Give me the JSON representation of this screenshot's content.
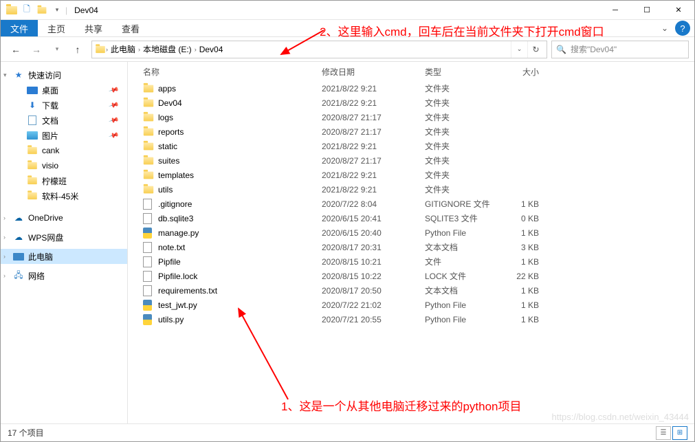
{
  "window": {
    "title": "Dev04"
  },
  "ribbon": {
    "file": "文件",
    "tabs": [
      "主页",
      "共享",
      "查看"
    ]
  },
  "nav": {
    "crumbs": [
      "此电脑",
      "本地磁盘 (E:)",
      "Dev04"
    ],
    "search_placeholder": "搜索\"Dev04\""
  },
  "sidebar": {
    "quick": "快速访问",
    "quick_items": [
      {
        "label": "桌面",
        "icon": "desktop",
        "pin": true
      },
      {
        "label": "下载",
        "icon": "download",
        "pin": true
      },
      {
        "label": "文档",
        "icon": "doc",
        "pin": true
      },
      {
        "label": "图片",
        "icon": "pic",
        "pin": true
      },
      {
        "label": "cank",
        "icon": "folder",
        "pin": false
      },
      {
        "label": "visio",
        "icon": "folder",
        "pin": false
      },
      {
        "label": "柠檬班",
        "icon": "folder",
        "pin": false
      },
      {
        "label": "软料-45米",
        "icon": "folder",
        "pin": false
      }
    ],
    "onedrive": "OneDrive",
    "wps": "WPS网盘",
    "thispc": "此电脑",
    "network": "网络"
  },
  "columns": {
    "name": "名称",
    "date": "修改日期",
    "type": "类型",
    "size": "大小"
  },
  "files": [
    {
      "icon": "folder",
      "name": "apps",
      "date": "2021/8/22 9:21",
      "type": "文件夹",
      "size": ""
    },
    {
      "icon": "folder",
      "name": "Dev04",
      "date": "2021/8/22 9:21",
      "type": "文件夹",
      "size": ""
    },
    {
      "icon": "folder",
      "name": "logs",
      "date": "2020/8/27 21:17",
      "type": "文件夹",
      "size": ""
    },
    {
      "icon": "folder",
      "name": "reports",
      "date": "2020/8/27 21:17",
      "type": "文件夹",
      "size": ""
    },
    {
      "icon": "folder",
      "name": "static",
      "date": "2021/8/22 9:21",
      "type": "文件夹",
      "size": ""
    },
    {
      "icon": "folder",
      "name": "suites",
      "date": "2020/8/27 21:17",
      "type": "文件夹",
      "size": ""
    },
    {
      "icon": "folder",
      "name": "templates",
      "date": "2021/8/22 9:21",
      "type": "文件夹",
      "size": ""
    },
    {
      "icon": "folder",
      "name": "utils",
      "date": "2021/8/22 9:21",
      "type": "文件夹",
      "size": ""
    },
    {
      "icon": "file",
      "name": ".gitignore",
      "date": "2020/7/22 8:04",
      "type": "GITIGNORE 文件",
      "size": "1 KB"
    },
    {
      "icon": "file",
      "name": "db.sqlite3",
      "date": "2020/6/15 20:41",
      "type": "SQLITE3 文件",
      "size": "0 KB"
    },
    {
      "icon": "py",
      "name": "manage.py",
      "date": "2020/6/15 20:40",
      "type": "Python File",
      "size": "1 KB"
    },
    {
      "icon": "file",
      "name": "note.txt",
      "date": "2020/8/17 20:31",
      "type": "文本文档",
      "size": "3 KB"
    },
    {
      "icon": "file",
      "name": "Pipfile",
      "date": "2020/8/15 10:21",
      "type": "文件",
      "size": "1 KB"
    },
    {
      "icon": "file",
      "name": "Pipfile.lock",
      "date": "2020/8/15 10:22",
      "type": "LOCK 文件",
      "size": "22 KB"
    },
    {
      "icon": "file",
      "name": "requirements.txt",
      "date": "2020/8/17 20:50",
      "type": "文本文档",
      "size": "1 KB"
    },
    {
      "icon": "py",
      "name": "test_jwt.py",
      "date": "2020/7/22 21:02",
      "type": "Python File",
      "size": "1 KB"
    },
    {
      "icon": "py",
      "name": "utils.py",
      "date": "2020/7/21 20:55",
      "type": "Python File",
      "size": "1 KB"
    }
  ],
  "status": {
    "count": "17 个项目"
  },
  "annotations": {
    "a1": "1、这是一个从其他电脑迁移过来的python项目",
    "a2": "2、这里输入cmd，回车后在当前文件夹下打开cmd窗口"
  },
  "watermark": "https://blog.csdn.net/weixin_43444"
}
